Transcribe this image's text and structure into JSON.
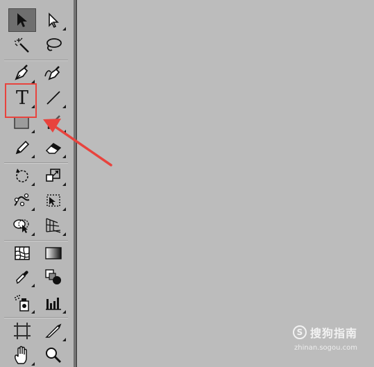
{
  "toolbar": {
    "type_tool": {
      "glyph": "T"
    }
  },
  "tools": [
    {
      "name": "selection-tool",
      "icon": "selection-arrow-icon",
      "active": true
    },
    {
      "name": "direct-selection-tool",
      "icon": "direct-selection-arrow-icon"
    },
    {
      "name": "magic-wand-tool",
      "icon": "magic-wand-icon"
    },
    {
      "name": "lasso-tool",
      "icon": "lasso-icon"
    },
    {
      "name": "pen-tool",
      "icon": "pen-icon"
    },
    {
      "name": "curvature-pen-tool",
      "icon": "curvature-pen-icon"
    },
    {
      "name": "type-tool",
      "icon": "type-icon",
      "highlighted": true
    },
    {
      "name": "line-segment-tool",
      "icon": "line-icon"
    },
    {
      "name": "rectangle-tool",
      "icon": "rectangle-icon"
    },
    {
      "name": "paintbrush-tool",
      "icon": "paintbrush-icon"
    },
    {
      "name": "pencil-tool",
      "icon": "pencil-icon"
    },
    {
      "name": "eraser-tool",
      "icon": "eraser-icon"
    },
    {
      "name": "rotate-tool",
      "icon": "rotate-icon"
    },
    {
      "name": "scale-tool",
      "icon": "scale-icon"
    },
    {
      "name": "puppet-warp-tool",
      "icon": "puppet-warp-icon"
    },
    {
      "name": "free-transform-tool",
      "icon": "free-transform-icon"
    },
    {
      "name": "shape-builder-tool",
      "icon": "shape-builder-icon"
    },
    {
      "name": "perspective-grid-tool",
      "icon": "perspective-grid-icon"
    },
    {
      "name": "mesh-tool",
      "icon": "mesh-icon"
    },
    {
      "name": "gradient-tool",
      "icon": "gradient-icon"
    },
    {
      "name": "eyedropper-tool",
      "icon": "eyedropper-icon"
    },
    {
      "name": "blend-tool",
      "icon": "blend-icon"
    },
    {
      "name": "symbol-sprayer-tool",
      "icon": "symbol-sprayer-icon"
    },
    {
      "name": "column-graph-tool",
      "icon": "column-graph-icon"
    },
    {
      "name": "artboard-tool",
      "icon": "artboard-icon"
    },
    {
      "name": "slice-tool",
      "icon": "slice-icon"
    },
    {
      "name": "hand-tool",
      "icon": "hand-icon"
    },
    {
      "name": "zoom-tool",
      "icon": "zoom-icon"
    }
  ],
  "annotation": {
    "highlight_color": "#e8433d",
    "arrow_color": "#e8433d"
  },
  "watermark": {
    "text": "搜狗指南",
    "url": "zhinan.sogou.com"
  },
  "colors": {
    "toolbar_bg": "#b8b8b8",
    "canvas_bg": "#bcbcbc",
    "active_tool_bg": "#6f6f6f"
  }
}
